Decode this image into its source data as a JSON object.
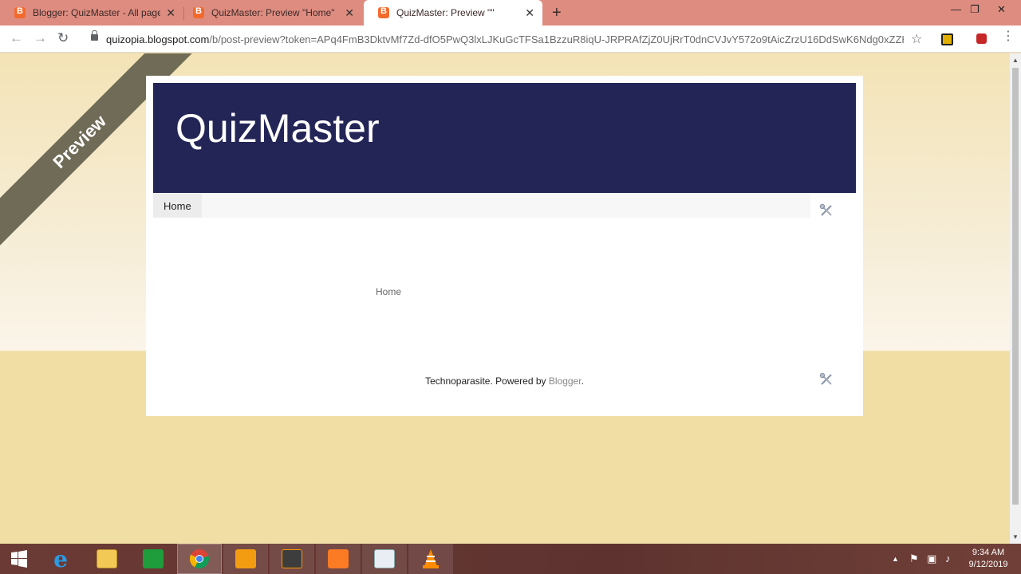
{
  "browser": {
    "tabs": [
      {
        "title": "Blogger: QuizMaster - All pages",
        "active": false
      },
      {
        "title": "QuizMaster: Preview \"Home\"",
        "active": false
      },
      {
        "title": "QuizMaster: Preview \"\"",
        "active": true
      }
    ],
    "new_tab": "+",
    "window_controls": {
      "minimize": "—",
      "restore": "❐",
      "close": "✕"
    },
    "url_host": "quizopia.blogspot.com",
    "url_rest": "/b/post-preview?token=APq4FmB3DktvMf7Zd-dfO5PwQ3lxLJKuGcTFSa1BzzuR8iqU-JRPRAfZjZ0UjRrT0dnCVJvY572o9tAicZrzU16DdSwK6Ndg0xZZH..."
  },
  "page": {
    "ribbon": "Preview",
    "blog_title": "QuizMaster",
    "tab_home": "Home",
    "breadcrumb": "Home",
    "footer_text": "Technoparasite. Powered by ",
    "footer_link": "Blogger",
    "footer_end": "."
  },
  "taskbar": {
    "clock_time": "9:34 AM",
    "clock_date": "9/12/2019"
  },
  "colors": {
    "header_bg": "#232556",
    "page_bg": "#f0dea5",
    "tabstrip_bg": "#de8c80",
    "ribbon_bg": "#6f6b57"
  }
}
